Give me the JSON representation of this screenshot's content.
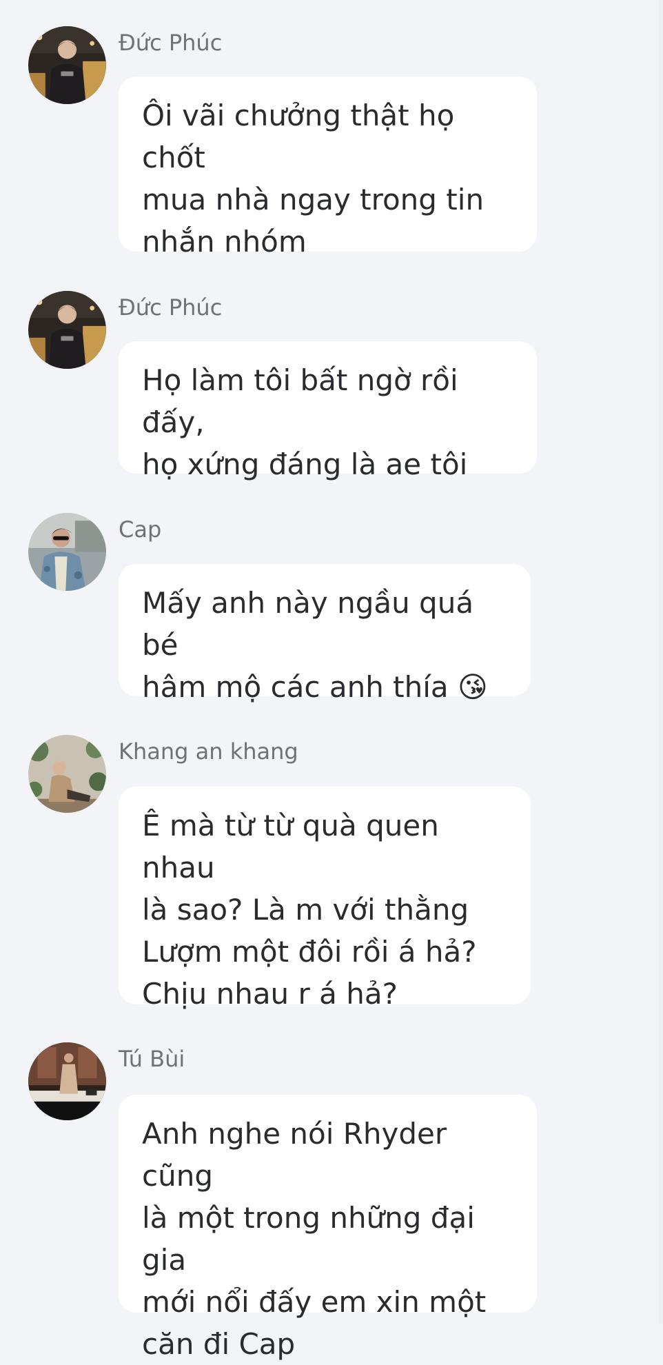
{
  "messages": [
    {
      "sender": "Đức Phúc",
      "avatar": "duc-phuc-avatar",
      "text": "Ôi vãi chưởng thật họ chốt\nmua nhà ngay trong tin\nnhắn nhóm"
    },
    {
      "sender": "Đức Phúc",
      "avatar": "duc-phuc-avatar",
      "text": "Họ làm tôi bất ngờ rồi đấy,\nhọ xứng đáng là ae tôi"
    },
    {
      "sender": "Cap",
      "avatar": "cap-avatar",
      "text": "Mấy anh này ngầu quá bé\nhâm mộ các anh thía 😘"
    },
    {
      "sender": "Khang an khang",
      "avatar": "khang-an-khang-avatar",
      "text": "Ê mà từ từ quà quen nhau\nlà sao? Là m với thằng\nLượm một đôi rồi á hả?\nChịu nhau r á hả?"
    },
    {
      "sender": "Tú Bùi",
      "avatar": "tu-bui-avatar",
      "text": "Anh nghe nói Rhyder cũng\nlà một trong những đại gia\nmới nổi đấy em xin một\ncăn đi Cap"
    }
  ]
}
